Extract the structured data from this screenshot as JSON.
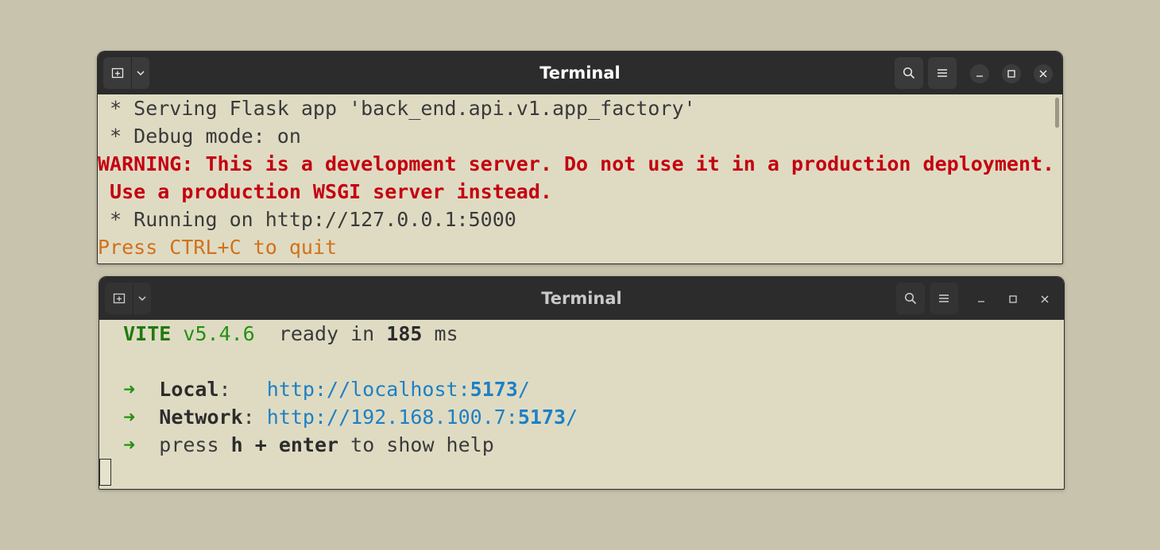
{
  "colors": {
    "desktop": "#c8c3ad",
    "terminal_bg": "#dfdbc3",
    "titlebar": "#2c2c2c",
    "warning_red": "#c4000f",
    "quit_orange": "#d2711a",
    "vite_green": "#239110",
    "link_blue": "#1d80c4"
  },
  "icons": {
    "new_tab": "new-tab-icon",
    "tab_dropdown": "chevron-down-icon",
    "search": "search-icon",
    "menu": "hamburger-menu-icon",
    "minimize": "minimize-icon",
    "maximize": "maximize-icon",
    "close": "close-icon"
  },
  "window1": {
    "title": "Terminal",
    "lines": {
      "l1": " * Serving Flask app 'back_end.api.v1.app_factory'",
      "l2": " * Debug mode: on",
      "l3": "WARNING: This is a development server. Do not use it in a production deployment.",
      "l4": " Use a production WSGI server instead.",
      "l5": " * Running on http://127.0.0.1:5000",
      "l6": "Press CTRL+C to quit"
    }
  },
  "window2": {
    "title": "Terminal",
    "vite": {
      "name": "VITE",
      "version": "v5.4.6",
      "ready_text": "ready in",
      "ready_ms": "185",
      "ms_unit": "ms"
    },
    "arrow": "➜",
    "local": {
      "label": "Local",
      "colon": ":",
      "url_prefix": "http://localhost:",
      "port": "5173",
      "slash": "/"
    },
    "network": {
      "label": "Network",
      "colon": ":",
      "url_prefix": "http://192.168.100.7:",
      "port": "5173",
      "slash": "/"
    },
    "help": {
      "press": "press",
      "key": "h + enter",
      "rest": "to show help"
    }
  }
}
